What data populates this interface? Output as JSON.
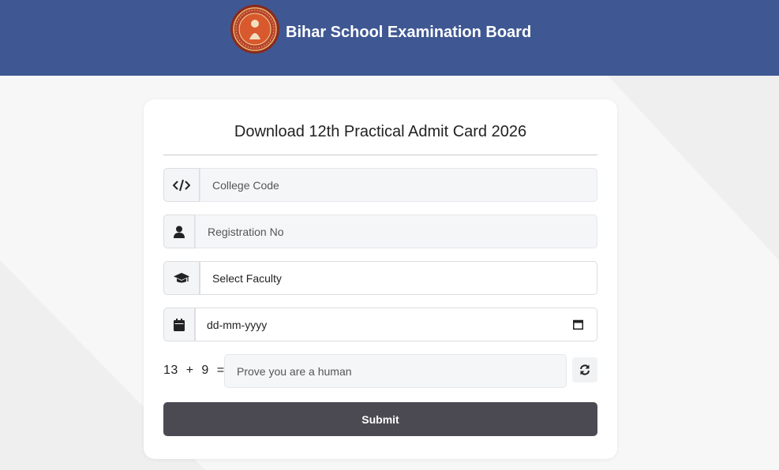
{
  "header": {
    "title": "Bihar School Examination Board",
    "logo_icon": "bseb-seal-logo",
    "bg_color": "#3f5893"
  },
  "form": {
    "title": "Download 12th Practical Admit Card 2026",
    "college_code": {
      "placeholder": "College Code",
      "icon": "code-icon"
    },
    "registration_no": {
      "placeholder": "Registration No",
      "icon": "user-icon"
    },
    "faculty": {
      "selected": "Select Faculty",
      "icon": "graduation-cap-icon"
    },
    "date": {
      "placeholder": "dd-mm-yyyy",
      "icon": "calendar-icon"
    },
    "captcha": {
      "question": "13  +  9  =",
      "placeholder": "Prove you are a human",
      "refresh_icon": "refresh-icon"
    },
    "submit_label": "Submit",
    "submit_color": "#4b4a53"
  }
}
